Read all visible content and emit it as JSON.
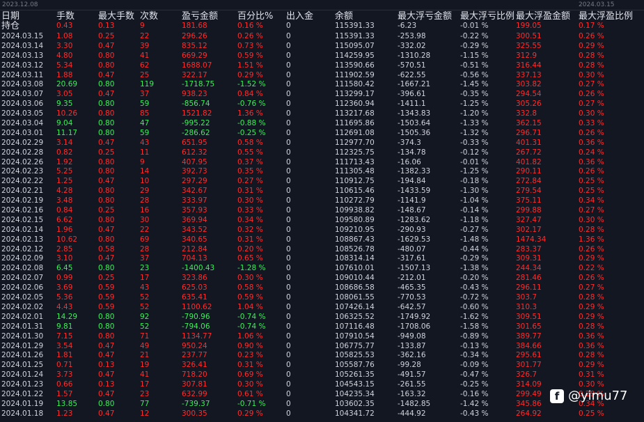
{
  "scale": {
    "left_date": "2023.12.08",
    "right_date": "2024.03.15"
  },
  "headers": [
    "日期",
    "手数",
    "最大手数",
    "次数",
    "盈亏金额",
    "百分比%",
    "出入金",
    "余额",
    "最大浮亏金额",
    "最大浮亏比例",
    "最大浮盈金额",
    "最大浮盈比例"
  ],
  "hold_label": "持仓",
  "rows": [
    [
      "2024.03.15",
      "1.08",
      "0.25",
      "22",
      "296.26",
      "0.26 %",
      "0",
      "115391.33",
      "-253.98",
      "-0.22 %",
      "300.51",
      "0.26 %"
    ],
    [
      "2024.03.14",
      "3.30",
      "0.47",
      "39",
      "835.12",
      "0.73 %",
      "0",
      "115095.07",
      "-332.02",
      "-0.29 %",
      "325.55",
      "0.29 %"
    ],
    [
      "2024.03.13",
      "4.80",
      "0.80",
      "41",
      "669.29",
      "0.59 %",
      "0",
      "114259.95",
      "-1310.28",
      "-1.15 %",
      "312.9",
      "0.28 %"
    ],
    [
      "2024.03.12",
      "5.34",
      "0.80",
      "62",
      "1688.07",
      "1.51 %",
      "0",
      "113590.66",
      "-570.51",
      "-0.51 %",
      "316.44",
      "0.28 %"
    ],
    [
      "2024.03.11",
      "1.88",
      "0.47",
      "25",
      "322.17",
      "0.29 %",
      "0",
      "111902.59",
      "-622.55",
      "-0.56 %",
      "337.13",
      "0.30 %"
    ],
    [
      "2024.03.08",
      "20.69",
      "0.80",
      "119",
      "-1718.75",
      "-1.52 %",
      "0",
      "111580.42",
      "-1667.21",
      "-1.45 %",
      "303.82",
      "0.27 %"
    ],
    [
      "2024.03.07",
      "3.05",
      "0.47",
      "37",
      "938.23",
      "0.84 %",
      "0",
      "113299.17",
      "-396.61",
      "-0.35 %",
      "294.54",
      "0.26 %"
    ],
    [
      "2024.03.06",
      "9.35",
      "0.80",
      "59",
      "-856.74",
      "-0.76 %",
      "0",
      "112360.94",
      "-1411.1",
      "-1.25 %",
      "305.26",
      "0.27 %"
    ],
    [
      "2024.03.05",
      "10.26",
      "0.80",
      "85",
      "1521.82",
      "1.36 %",
      "0",
      "113217.68",
      "-1343.83",
      "-1.20 %",
      "332.8",
      "0.30 %"
    ],
    [
      "2024.03.04",
      "9.04",
      "0.80",
      "47",
      "-995.22",
      "-0.88 %",
      "0",
      "111695.86",
      "-1503.64",
      "-1.33 %",
      "362.15",
      "0.33 %"
    ],
    [
      "2024.03.01",
      "11.17",
      "0.80",
      "59",
      "-286.62",
      "-0.25 %",
      "0",
      "112691.08",
      "-1505.36",
      "-1.32 %",
      "296.71",
      "0.26 %"
    ],
    [
      "2024.02.29",
      "3.14",
      "0.47",
      "43",
      "651.95",
      "0.58 %",
      "0",
      "112977.70",
      "-374.3",
      "-0.33 %",
      "401.31",
      "0.36 %"
    ],
    [
      "2024.02.28",
      "0.82",
      "0.25",
      "11",
      "612.32",
      "0.55 %",
      "0",
      "112325.75",
      "-134.78",
      "-0.12 %",
      "267.72",
      "0.24 %"
    ],
    [
      "2024.02.26",
      "1.92",
      "0.80",
      "9",
      "407.95",
      "0.37 %",
      "0",
      "111713.43",
      "-16.06",
      "-0.01 %",
      "401.82",
      "0.36 %"
    ],
    [
      "2024.02.23",
      "5.25",
      "0.80",
      "14",
      "392.73",
      "0.35 %",
      "0",
      "111305.48",
      "-1382.33",
      "-1.25 %",
      "290.11",
      "0.26 %"
    ],
    [
      "2024.02.22",
      "1.25",
      "0.47",
      "10",
      "297.29",
      "0.27 %",
      "0",
      "110912.75",
      "-194.84",
      "-0.18 %",
      "272.84",
      "0.25 %"
    ],
    [
      "2024.02.21",
      "4.28",
      "0.80",
      "29",
      "342.67",
      "0.31 %",
      "0",
      "110615.46",
      "-1433.59",
      "-1.30 %",
      "279.54",
      "0.25 %"
    ],
    [
      "2024.02.19",
      "3.48",
      "0.80",
      "28",
      "333.97",
      "0.30 %",
      "0",
      "110272.79",
      "-1141.9",
      "-1.04 %",
      "375.11",
      "0.34 %"
    ],
    [
      "2024.02.16",
      "0.84",
      "0.25",
      "16",
      "357.93",
      "0.33 %",
      "0",
      "109938.82",
      "-148.67",
      "-0.14 %",
      "299.88",
      "0.27 %"
    ],
    [
      "2024.02.15",
      "6.62",
      "0.80",
      "30",
      "369.94",
      "0.34 %",
      "0",
      "109580.89",
      "-1283.62",
      "-1.18 %",
      "327.47",
      "0.30 %"
    ],
    [
      "2024.02.14",
      "1.96",
      "0.47",
      "22",
      "343.52",
      "0.32 %",
      "0",
      "109210.95",
      "-290.93",
      "-0.27 %",
      "302.17",
      "0.28 %"
    ],
    [
      "2024.02.13",
      "10.62",
      "0.80",
      "69",
      "340.65",
      "0.31 %",
      "0",
      "108867.43",
      "-1629.53",
      "-1.48 %",
      "1474.34",
      "1.36 %"
    ],
    [
      "2024.02.12",
      "2.85",
      "0.58",
      "28",
      "212.84",
      "0.20 %",
      "0",
      "108526.78",
      "-480.07",
      "-0.44 %",
      "283.37",
      "0.26 %"
    ],
    [
      "2024.02.09",
      "3.10",
      "0.47",
      "37",
      "704.13",
      "0.65 %",
      "0",
      "108314.14",
      "-317.61",
      "-0.29 %",
      "309.31",
      "0.29 %"
    ],
    [
      "2024.02.08",
      "6.45",
      "0.80",
      "23",
      "-1400.43",
      "-1.28 %",
      "0",
      "107610.01",
      "-1507.13",
      "-1.38 %",
      "244.34",
      "0.22 %"
    ],
    [
      "2024.02.07",
      "0.99",
      "0.25",
      "17",
      "323.86",
      "0.30 %",
      "0",
      "109010.44",
      "-212.01",
      "-0.20 %",
      "281.46",
      "0.26 %"
    ],
    [
      "2024.02.06",
      "3.69",
      "0.59",
      "43",
      "625.03",
      "0.58 %",
      "0",
      "108686.58",
      "-465.35",
      "-0.43 %",
      "296.11",
      "0.27 %"
    ],
    [
      "2024.02.05",
      "5.36",
      "0.59",
      "52",
      "635.41",
      "0.59 %",
      "0",
      "108061.55",
      "-770.53",
      "-0.72 %",
      "303.7",
      "0.28 %"
    ],
    [
      "2024.02.02",
      "4.43",
      "0.59",
      "52",
      "1100.62",
      "1.04 %",
      "0",
      "107426.14",
      "-642.57",
      "-0.60 %",
      "310.3",
      "0.29 %"
    ],
    [
      "2024.02.01",
      "14.29",
      "0.80",
      "92",
      "-790.96",
      "-0.74 %",
      "0",
      "106325.52",
      "-1749.92",
      "-1.62 %",
      "309.51",
      "0.29 %"
    ],
    [
      "2024.01.31",
      "9.81",
      "0.80",
      "52",
      "-794.06",
      "-0.74 %",
      "0",
      "107116.48",
      "-1708.06",
      "-1.58 %",
      "301.65",
      "0.28 %"
    ],
    [
      "2024.01.30",
      "7.15",
      "0.80",
      "71",
      "1134.77",
      "1.06 %",
      "0",
      "107910.54",
      "-949.08",
      "-0.89 %",
      "389.77",
      "0.36 %"
    ],
    [
      "2024.01.29",
      "3.54",
      "0.47",
      "49",
      "950.24",
      "0.90 %",
      "0",
      "106775.77",
      "-133.87",
      "-0.13 %",
      "384.66",
      "0.36 %"
    ],
    [
      "2024.01.26",
      "1.81",
      "0.47",
      "21",
      "237.77",
      "0.23 %",
      "0",
      "105825.53",
      "-362.16",
      "-0.34 %",
      "295.61",
      "0.28 %"
    ],
    [
      "2024.01.25",
      "0.71",
      "0.13",
      "19",
      "326.41",
      "0.31 %",
      "0",
      "105587.76",
      "-99.28",
      "-0.09 %",
      "301.77",
      "0.29 %"
    ],
    [
      "2024.01.24",
      "3.73",
      "0.47",
      "41",
      "718.20",
      "0.69 %",
      "0",
      "105261.35",
      "-491.57",
      "-0.47 %",
      "326.7",
      "0.31 %"
    ],
    [
      "2024.01.23",
      "0.66",
      "0.13",
      "17",
      "307.81",
      "0.30 %",
      "0",
      "104543.15",
      "-261.55",
      "-0.25 %",
      "314.09",
      "0.30 %"
    ],
    [
      "2024.01.22",
      "1.57",
      "0.47",
      "23",
      "632.99",
      "0.61 %",
      "0",
      "104235.34",
      "-163.32",
      "-0.16 %",
      "299.49",
      "0.29 %"
    ],
    [
      "2024.01.19",
      "13.85",
      "0.80",
      "77",
      "-739.37",
      "-0.71 %",
      "0",
      "103602.35",
      "-1482.85",
      "-1.42 %",
      "345.86",
      "0.34 %"
    ],
    [
      "2024.01.18",
      "1.23",
      "0.47",
      "12",
      "300.35",
      "0.29 %",
      "0",
      "104341.72",
      "-444.92",
      "-0.43 %",
      "264.92",
      "0.25 %"
    ]
  ],
  "hold_row": {
    "lots": "0.43",
    "max_lots": "0.13",
    "count": "9",
    "pnl": "181.68",
    "pct": "0.16 %",
    "cash": "0",
    "balance": "115391.33",
    "max_float_loss": "-6.23",
    "max_float_loss_pct": "-0.01 %",
    "max_float_profit": "199.05",
    "max_float_profit_pct": "0.17 %"
  },
  "watermark": {
    "icon": "facebook-icon",
    "text": "@yimu77"
  },
  "colors": {
    "background": "#131722",
    "profit": "#ff2d2d",
    "loss": "#3cf05a",
    "text": "#d1d4dc"
  }
}
